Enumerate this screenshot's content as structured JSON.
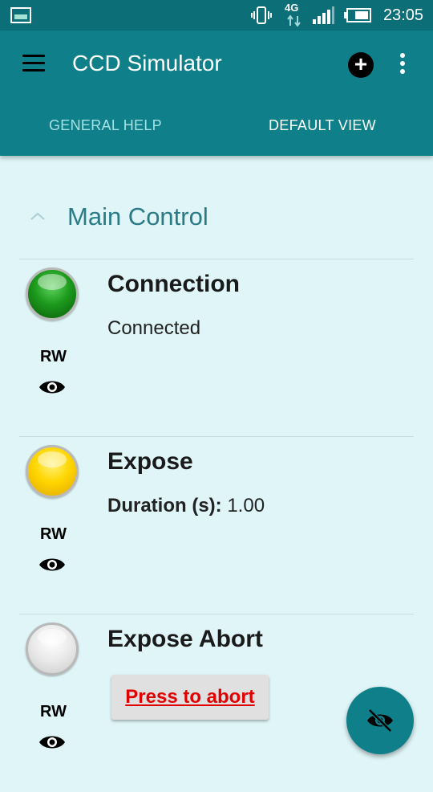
{
  "status_bar": {
    "network": "4G",
    "time": "23:05"
  },
  "app_bar": {
    "title": "CCD Simulator"
  },
  "tabs": [
    {
      "label": "GENERAL HELP"
    },
    {
      "label": "DEFAULT VIEW"
    }
  ],
  "section": {
    "title": "Main Control"
  },
  "properties": [
    {
      "title": "Connection",
      "status_color": "green",
      "permission": "RW",
      "value_text": "Connected"
    },
    {
      "title": "Expose",
      "status_color": "yellow",
      "permission": "RW",
      "label": "Duration (s):",
      "value": "1.00"
    },
    {
      "title": "Expose Abort",
      "status_color": "grey",
      "permission": "RW",
      "button_label": "Press to abort"
    }
  ],
  "colors": {
    "primary": "#0f808a",
    "status_bar": "#0c6f78",
    "background": "#dff5f7",
    "abort_text": "#e10000"
  },
  "icons": {
    "menu": "hamburger-icon",
    "add": "add-circle-icon",
    "more": "more-vert-icon",
    "eye": "eye-icon",
    "fab": "eye-off-icon"
  }
}
